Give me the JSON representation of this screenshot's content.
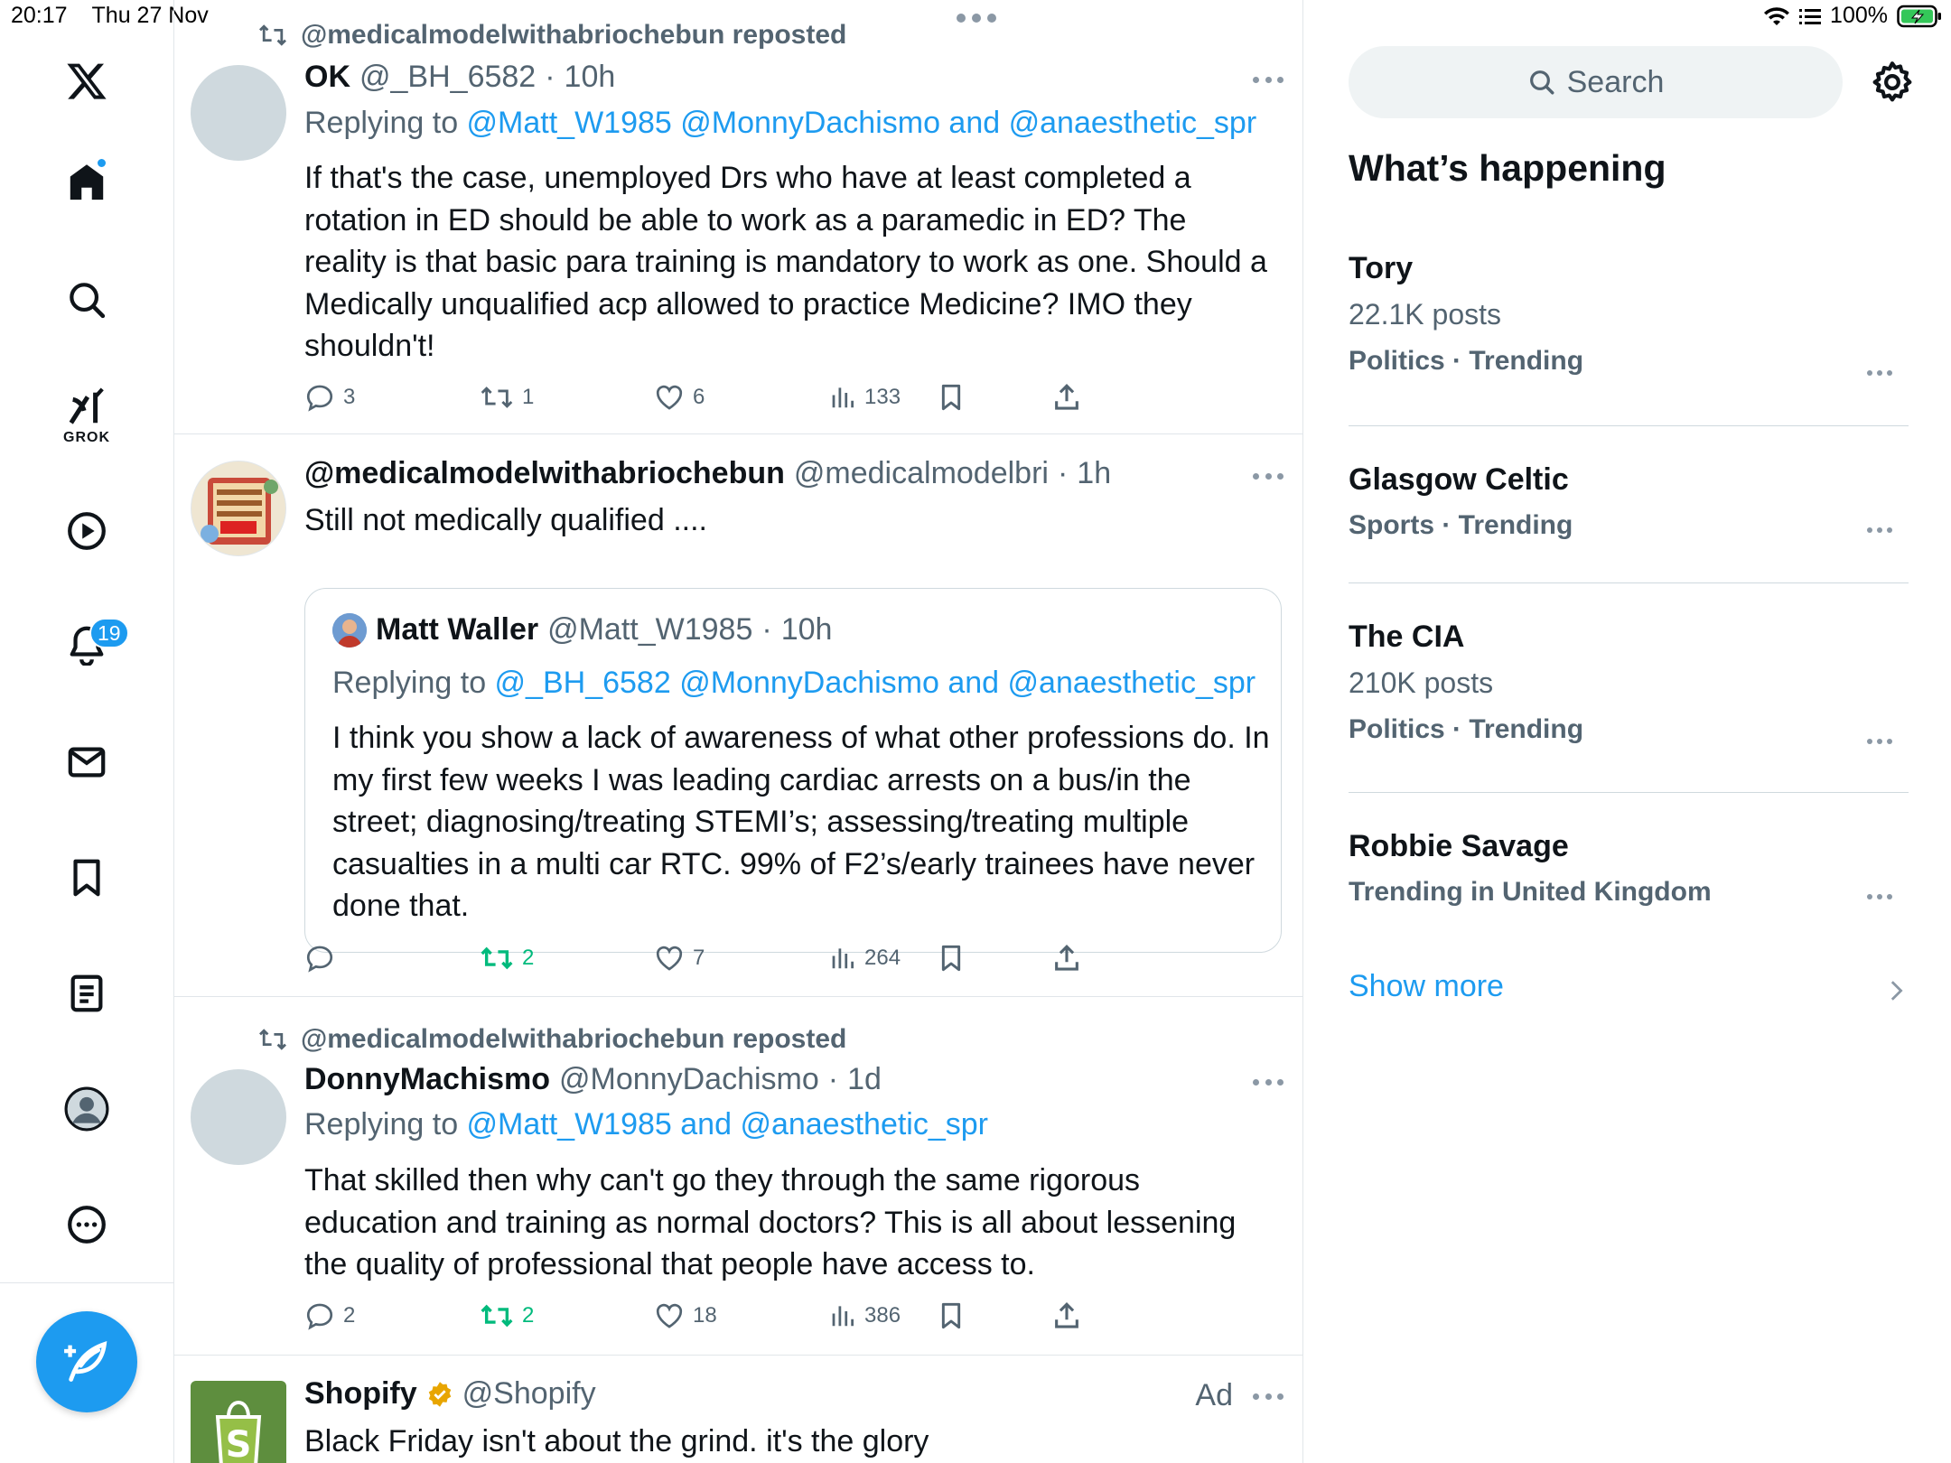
{
  "status": {
    "time": "20:17",
    "date": "Thu 27 Nov",
    "battery": "100%"
  },
  "sidebar": {
    "grok_label": "GROK",
    "notifications_count": "19"
  },
  "tweets": [
    {
      "reposted_by": "@medicalmodelwithabriochebun reposted",
      "name": "OK",
      "handle": "@_BH_6582",
      "time": "10h",
      "replying_prefix": "Replying to ",
      "replying_to": "@Matt_W1985 @MonnyDachismo and @anaesthetic_spr",
      "text": "If that's the case, unemployed Drs who have at least completed a rotation in ED should be able to work as a paramedic in ED? The reality is that basic para training is mandatory to work as one. Should a Medically unqualified acp allowed to practice Medicine? IMO they shouldn't!",
      "replies": "3",
      "reposts": "1",
      "likes": "6",
      "views": "133"
    },
    {
      "name": "@medicalmodelwithabriochebun",
      "handle": "@medicalmodelbri",
      "time": "1h",
      "text": "Still not medically qualified ....",
      "avatar_text": "General Medical Council NO",
      "quote": {
        "name": "Matt Waller",
        "handle": "@Matt_W1985",
        "time": "10h",
        "replying_prefix": "Replying to ",
        "replying_to": "@_BH_6582 @MonnyDachismo and @anaesthetic_spr",
        "text": "I think you show a lack of awareness of what other professions do. In my first few weeks I was leading cardiac arrests on a bus/in the street; diagnosing/treating STEMI’s; assessing/treating multiple casualties in a multi car RTC. 99% of F2’s/early trainees have never done that."
      },
      "reposts": "2",
      "likes": "7",
      "views": "264"
    },
    {
      "reposted_by": "@medicalmodelwithabriochebun reposted",
      "name": "DonnyMachismo",
      "handle": "@MonnyDachismo",
      "time": "1d",
      "replying_prefix": "Replying to ",
      "replying_to": "@Matt_W1985 and @anaesthetic_spr",
      "text": "That skilled then why can't go they through the same rigorous education and training as normal doctors? This is all about lessening the quality of professional that people have access to.",
      "replies": "2",
      "reposts": "2",
      "likes": "18",
      "views": "386"
    },
    {
      "name": "Shopify",
      "handle": "@Shopify",
      "ad_label": "Ad",
      "text": "Black Friday isn't about the grind. it's the glory"
    }
  ],
  "right": {
    "search_placeholder": "Search",
    "section_title": "What’s happening",
    "trends": [
      {
        "title": "Tory",
        "meta": "22.1K posts",
        "category": "Politics · Trending"
      },
      {
        "title": "Glasgow Celtic",
        "category": "Sports · Trending"
      },
      {
        "title": "The CIA",
        "meta": "210K posts",
        "category": "Politics · Trending"
      },
      {
        "title": "Robbie Savage",
        "category": "Trending in United Kingdom"
      }
    ],
    "show_more": "Show more"
  },
  "colors": {
    "accent": "#1d9bf0",
    "repost_green": "#00ba7c",
    "muted": "#536471"
  }
}
